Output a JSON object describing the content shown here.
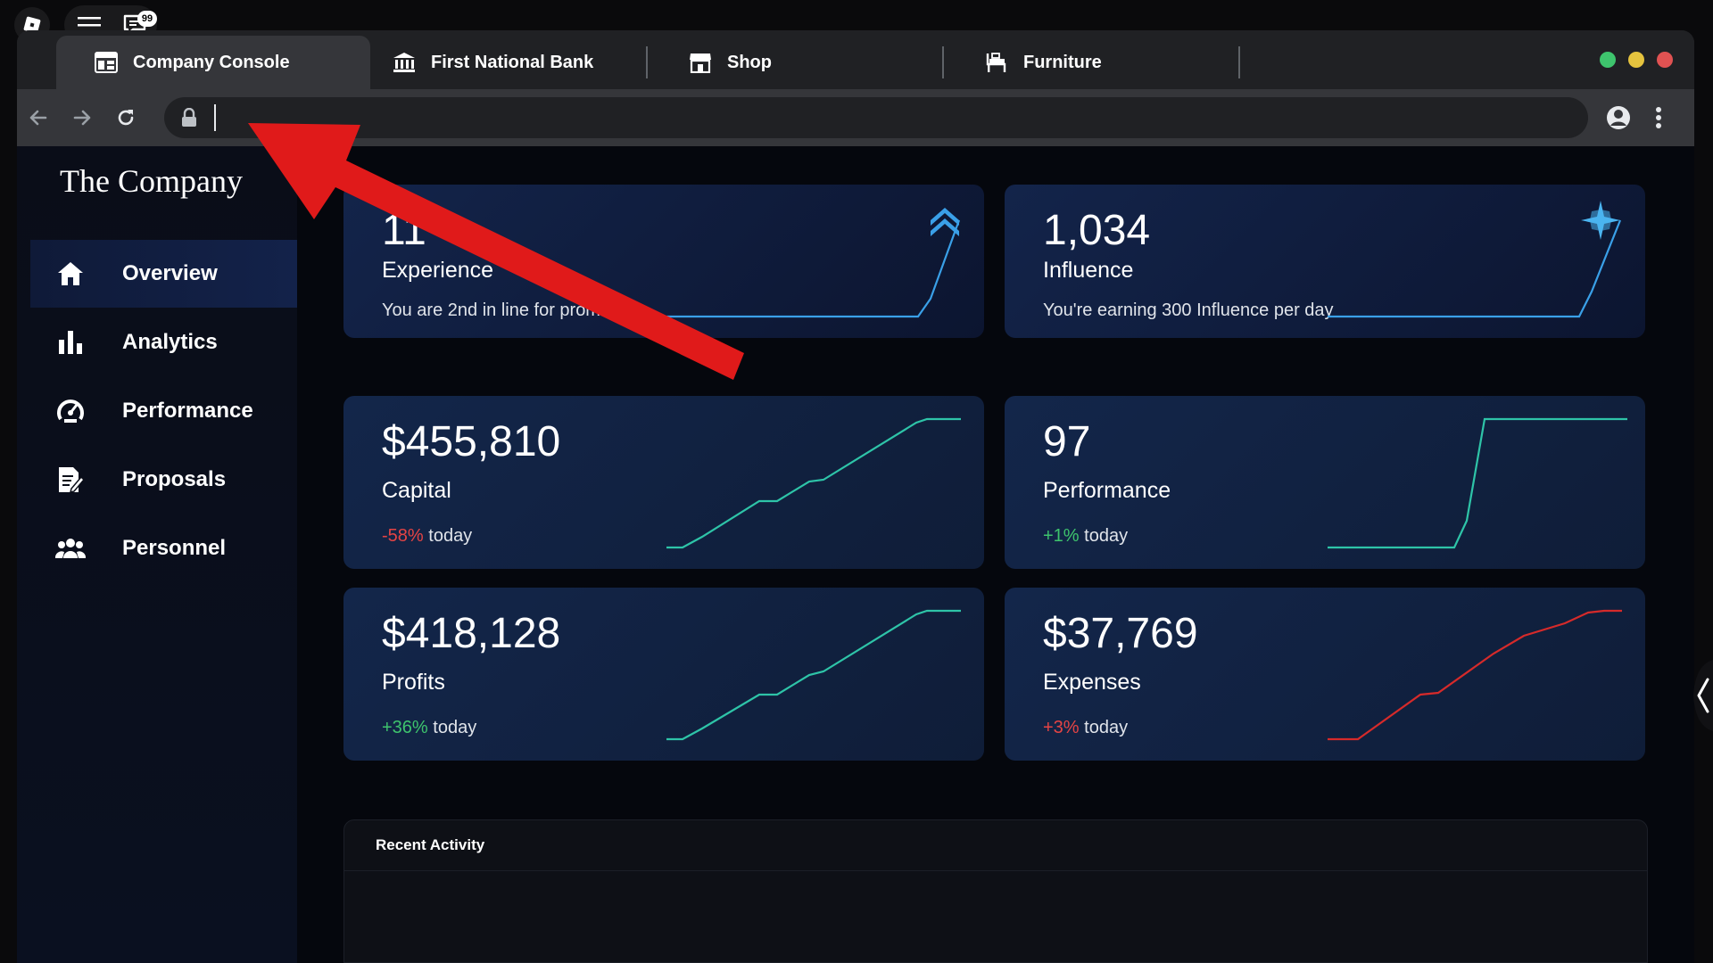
{
  "roblox": {
    "chat_badge": "99"
  },
  "browser": {
    "tabs": [
      {
        "label": "Company Console",
        "icon": "dashboard-icon",
        "active": true
      },
      {
        "label": "First National Bank",
        "icon": "bank-icon",
        "active": false
      },
      {
        "label": "Shop",
        "icon": "store-icon",
        "active": false
      },
      {
        "label": "Furniture",
        "icon": "furniture-icon",
        "active": false
      }
    ],
    "url": {
      "value": "",
      "placeholder": ""
    },
    "traffic_colors": {
      "green": "#3ec46d",
      "yellow": "#e5c33e",
      "red": "#e05252"
    }
  },
  "sidebar": {
    "brand": "The Company",
    "items": [
      {
        "label": "Overview",
        "icon": "home-icon",
        "active": true
      },
      {
        "label": "Analytics",
        "icon": "bar-chart-icon",
        "active": false
      },
      {
        "label": "Performance",
        "icon": "speedometer-icon",
        "active": false
      },
      {
        "label": "Proposals",
        "icon": "document-edit-icon",
        "active": false
      },
      {
        "label": "Personnel",
        "icon": "people-icon",
        "active": false
      }
    ]
  },
  "cards": {
    "experience": {
      "value": "11",
      "label": "Experience",
      "sub": "You are 2nd in line for promotion",
      "icon": "chevron-up-double-icon"
    },
    "influence": {
      "value": "1,034",
      "label": "Influence",
      "sub": "You're earning 300 Influence per day",
      "icon": "sparkle-icon"
    },
    "capital": {
      "value": "$455,810",
      "label": "Capital",
      "change": "-58%",
      "change_suffix": " today",
      "trend": "neg"
    },
    "performance": {
      "value": "97",
      "label": "Performance",
      "change": "+1%",
      "change_suffix": " today",
      "trend": "pos"
    },
    "profits": {
      "value": "$418,128",
      "label": "Profits",
      "change": "+36%",
      "change_suffix": " today",
      "trend": "pos"
    },
    "expenses": {
      "value": "$37,769",
      "label": "Expenses",
      "change": "+3%",
      "change_suffix": " today",
      "trend": "neg"
    }
  },
  "recent_activity": {
    "title": "Recent Activity"
  },
  "colors": {
    "spark_blue": "#3aa0e8",
    "spark_teal": "#2ec4a8",
    "spark_red": "#d62a2a",
    "arrow_red": "#e01a1a"
  }
}
